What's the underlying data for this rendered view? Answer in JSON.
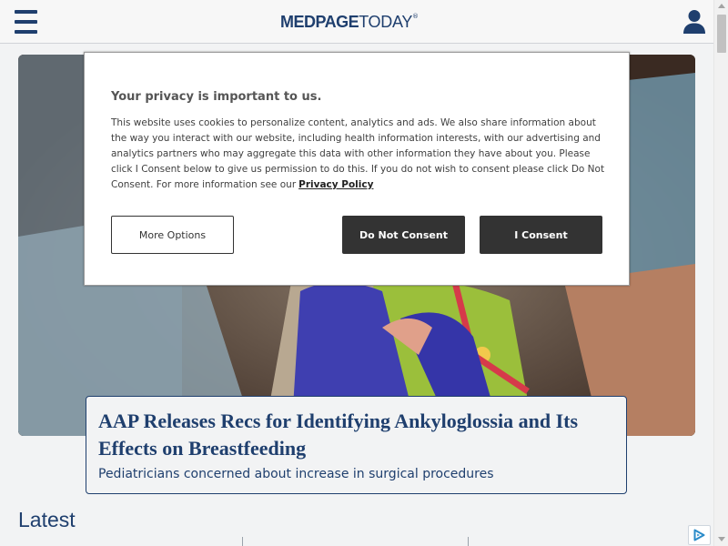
{
  "header": {
    "logo_med": "MEDPAGE",
    "logo_today": "TODAY",
    "logo_tm": "®"
  },
  "hero": {
    "headline": "AAP Releases Recs for Identifying Ankyloglossia and Its Effects on Breastfeeding",
    "subhead": "Pediatricians concerned about increase in surgical procedures"
  },
  "section": {
    "latest": "Latest"
  },
  "consent": {
    "title": "Your privacy is important to us.",
    "body": "This website uses cookies to personalize content, analytics and ads. We also share information about the way you interact with our website, including health information interests, with our advertising and analytics partners who may aggregate this data with other information they have about you. Please click I Consent below to give us permission to do this. If you do not wish to consent please click Do Not Consent. For more information see our",
    "policy_link": "Privacy Policy",
    "more_options": "More Options",
    "do_not_consent": "Do Not Consent",
    "i_consent": "I Consent"
  },
  "colors": {
    "brand": "#1f3f6e",
    "button_dark": "#333333",
    "background": "#f2f3f4"
  },
  "icons": {
    "menu": "hamburger-menu-icon",
    "account": "user-account-icon",
    "ad": "adchoices-icon"
  }
}
